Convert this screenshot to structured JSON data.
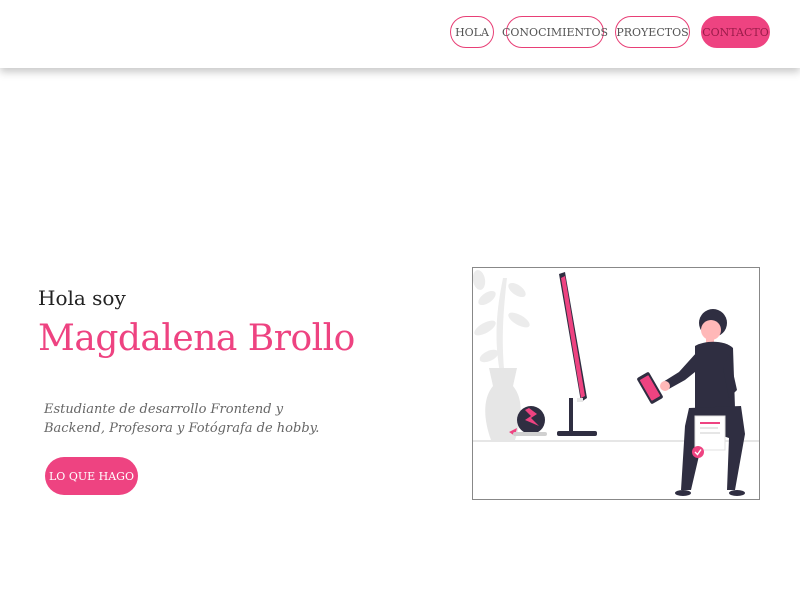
{
  "nav": {
    "items": [
      {
        "label": "HOLA"
      },
      {
        "label": "CONOCIMIENTOS"
      },
      {
        "label": "PROYECTOS"
      },
      {
        "label": "CONTACTO"
      }
    ]
  },
  "hero": {
    "greeting": "Hola soy",
    "name": "Magdalena Brollo",
    "description": "Estudiante de desarrollo Frontend y Backend, Profesora y Fotógrafa de hobby.",
    "cta_label": "LO QUE HAGO"
  },
  "colors": {
    "accent": "#ee4381",
    "dark": "#2f2e41"
  }
}
